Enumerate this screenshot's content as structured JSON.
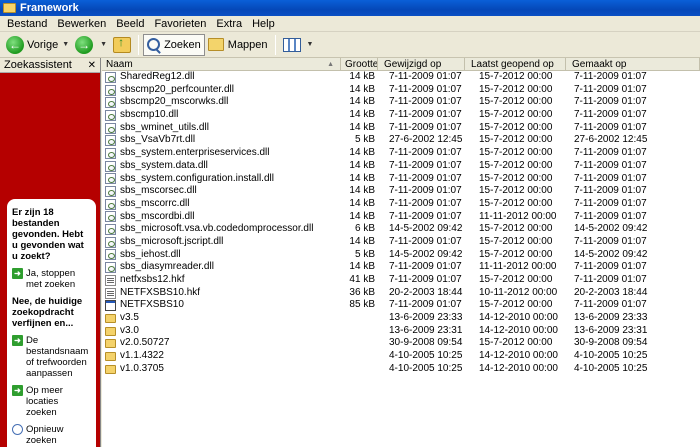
{
  "window": {
    "title": "Framework"
  },
  "menu": [
    "Bestand",
    "Bewerken",
    "Beeld",
    "Favorieten",
    "Extra",
    "Help"
  ],
  "toolbar": {
    "back_label": "Vorige",
    "search_label": "Zoeken",
    "folders_label": "Mappen"
  },
  "left_pane": {
    "title": "Zoekassistent",
    "question": "Er zijn 18 bestanden gevonden. Hebt u gevonden wat u zoekt?",
    "option_stop": "Ja, stoppen met zoeken",
    "refine_heading": "Nee, de huidige zoekopdracht verfijnen en...",
    "option_name": "De bestandsnaam of trefwoorden aanpassen",
    "option_locations": "Op meer locaties zoeken",
    "option_new": "Opnieuw zoeken"
  },
  "columns": {
    "name": "Naam",
    "size": "Grootte",
    "modified": "Gewijzigd op",
    "opened": "Laatst geopend op",
    "created": "Gemaakt op"
  },
  "files": [
    {
      "type": "dll",
      "name": "SharedReg12.dll",
      "size": "14 kB",
      "modified": "7-11-2009 01:07",
      "opened": "15-7-2012 00:00",
      "created": "7-11-2009 01:07"
    },
    {
      "type": "dll",
      "name": "sbscmp20_perfcounter.dll",
      "size": "14 kB",
      "modified": "7-11-2009 01:07",
      "opened": "15-7-2012 00:00",
      "created": "7-11-2009 01:07"
    },
    {
      "type": "dll",
      "name": "sbscmp20_mscorwks.dll",
      "size": "14 kB",
      "modified": "7-11-2009 01:07",
      "opened": "15-7-2012 00:00",
      "created": "7-11-2009 01:07"
    },
    {
      "type": "dll",
      "name": "sbscmp10.dll",
      "size": "14 kB",
      "modified": "7-11-2009 01:07",
      "opened": "15-7-2012 00:00",
      "created": "7-11-2009 01:07"
    },
    {
      "type": "dll",
      "name": "sbs_wminet_utils.dll",
      "size": "14 kB",
      "modified": "7-11-2009 01:07",
      "opened": "15-7-2012 00:00",
      "created": "7-11-2009 01:07"
    },
    {
      "type": "dll",
      "name": "sbs_VsaVb7rt.dll",
      "size": "5 kB",
      "modified": "27-6-2002 12:45",
      "opened": "15-7-2012 00:00",
      "created": "27-6-2002 12:45"
    },
    {
      "type": "dll",
      "name": "sbs_system.enterpriseservices.dll",
      "size": "14 kB",
      "modified": "7-11-2009 01:07",
      "opened": "15-7-2012 00:00",
      "created": "7-11-2009 01:07"
    },
    {
      "type": "dll",
      "name": "sbs_system.data.dll",
      "size": "14 kB",
      "modified": "7-11-2009 01:07",
      "opened": "15-7-2012 00:00",
      "created": "7-11-2009 01:07"
    },
    {
      "type": "dll",
      "name": "sbs_system.configuration.install.dll",
      "size": "14 kB",
      "modified": "7-11-2009 01:07",
      "opened": "15-7-2012 00:00",
      "created": "7-11-2009 01:07"
    },
    {
      "type": "dll",
      "name": "sbs_mscorsec.dll",
      "size": "14 kB",
      "modified": "7-11-2009 01:07",
      "opened": "15-7-2012 00:00",
      "created": "7-11-2009 01:07"
    },
    {
      "type": "dll",
      "name": "sbs_mscorrc.dll",
      "size": "14 kB",
      "modified": "7-11-2009 01:07",
      "opened": "15-7-2012 00:00",
      "created": "7-11-2009 01:07"
    },
    {
      "type": "dll",
      "name": "sbs_mscordbi.dll",
      "size": "14 kB",
      "modified": "7-11-2009 01:07",
      "opened": "11-11-2012 00:00",
      "created": "7-11-2009 01:07"
    },
    {
      "type": "dll",
      "name": "sbs_microsoft.vsa.vb.codedomprocessor.dll",
      "size": "6 kB",
      "modified": "14-5-2002 09:42",
      "opened": "15-7-2012 00:00",
      "created": "14-5-2002 09:42"
    },
    {
      "type": "dll",
      "name": "sbs_microsoft.jscript.dll",
      "size": "14 kB",
      "modified": "7-11-2009 01:07",
      "opened": "15-7-2012 00:00",
      "created": "7-11-2009 01:07"
    },
    {
      "type": "dll",
      "name": "sbs_iehost.dll",
      "size": "5 kB",
      "modified": "14-5-2002 09:42",
      "opened": "15-7-2012 00:00",
      "created": "14-5-2002 09:42"
    },
    {
      "type": "dll",
      "name": "sbs_diasymreader.dll",
      "size": "14 kB",
      "modified": "7-11-2009 01:07",
      "opened": "11-11-2012 00:00",
      "created": "7-11-2009 01:07"
    },
    {
      "type": "hkf",
      "name": "netfxsbs12.hkf",
      "size": "41 kB",
      "modified": "7-11-2009 01:07",
      "opened": "15-7-2012 00:00",
      "created": "7-11-2009 01:07"
    },
    {
      "type": "hkf",
      "name": "NETFXSBS10.hkf",
      "size": "36 kB",
      "modified": "20-2-2003 18:44",
      "opened": "10-11-2012 00:00",
      "created": "20-2-2003 18:44"
    },
    {
      "type": "exe",
      "name": "NETFXSBS10",
      "size": "85 kB",
      "modified": "7-11-2009 01:07",
      "opened": "15-7-2012 00:00",
      "created": "7-11-2009 01:07"
    },
    {
      "type": "folder",
      "name": "v3.5",
      "size": "",
      "modified": "13-6-2009 23:33",
      "opened": "14-12-2010 00:00",
      "created": "13-6-2009 23:33"
    },
    {
      "type": "folder",
      "name": "v3.0",
      "size": "",
      "modified": "13-6-2009 23:31",
      "opened": "14-12-2010 00:00",
      "created": "13-6-2009 23:31"
    },
    {
      "type": "folder",
      "name": "v2.0.50727",
      "size": "",
      "modified": "30-9-2008 09:54",
      "opened": "15-7-2012 00:00",
      "created": "30-9-2008 09:54"
    },
    {
      "type": "folder",
      "name": "v1.1.4322",
      "size": "",
      "modified": "4-10-2005 10:25",
      "opened": "14-12-2010 00:00",
      "created": "4-10-2005 10:25"
    },
    {
      "type": "folder",
      "name": "v1.0.3705",
      "size": "",
      "modified": "4-10-2005 10:25",
      "opened": "14-12-2010 00:00",
      "created": "4-10-2005 10:25"
    }
  ]
}
